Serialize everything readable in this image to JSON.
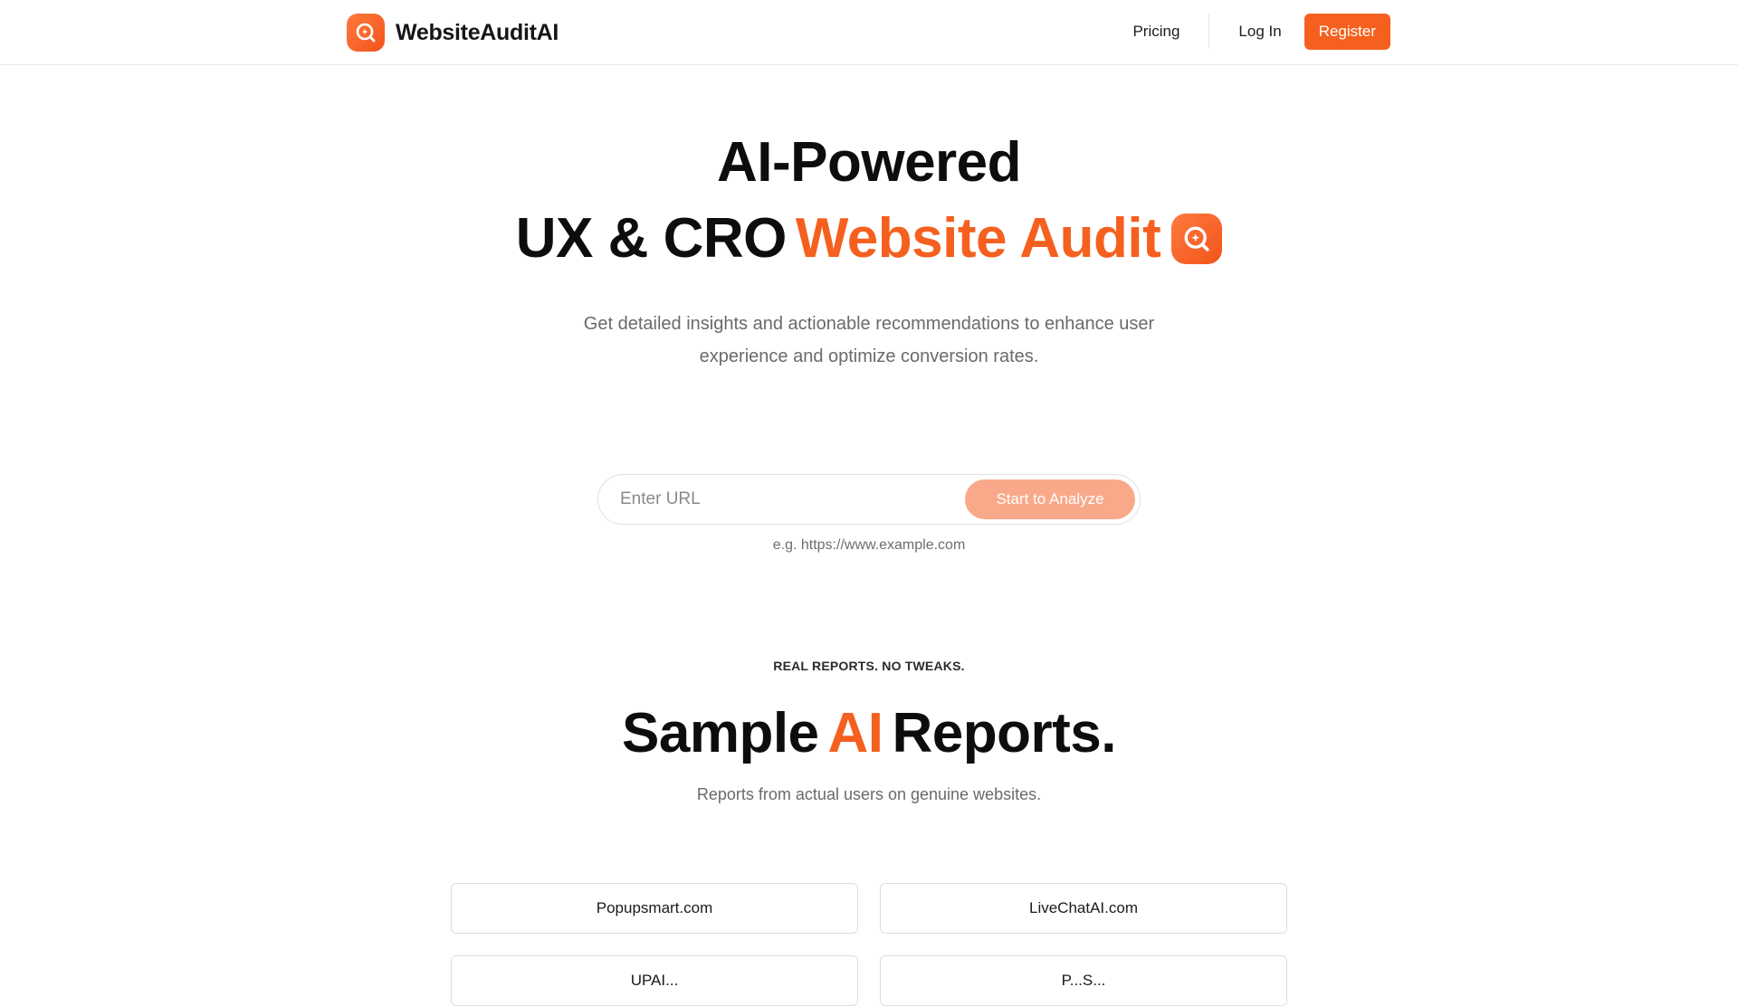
{
  "brand": {
    "name": "WebsiteAuditAI",
    "icon": "magnifier-plus-icon"
  },
  "nav": {
    "pricing": "Pricing",
    "login": "Log In",
    "register": "Register"
  },
  "hero": {
    "line1": "AI-Powered",
    "line2_plain": "UX & CRO",
    "line2_accent": "Website Audit",
    "subtitle": "Get detailed insights and actionable recommendations to enhance user experience and optimize conversion rates."
  },
  "search": {
    "placeholder": "Enter URL",
    "value": "",
    "button": "Start to Analyze",
    "hint": "e.g. https://www.example.com"
  },
  "samples": {
    "eyebrow": "REAL REPORTS. NO TWEAKS.",
    "title_a": "Sample",
    "title_accent": "AI",
    "title_b": "Reports.",
    "subtitle": "Reports from actual users on genuine websites.",
    "reports": [
      {
        "label": "Popupsmart.com"
      },
      {
        "label": "LiveChatAI.com"
      },
      {
        "label": "UPAI..."
      },
      {
        "label": "P...S..."
      }
    ]
  },
  "colors": {
    "accent": "#f5601f",
    "accent_light": "#f9a98a",
    "text": "#0d0d0d",
    "muted": "#6a6a6a",
    "border": "#e0e0e0"
  }
}
